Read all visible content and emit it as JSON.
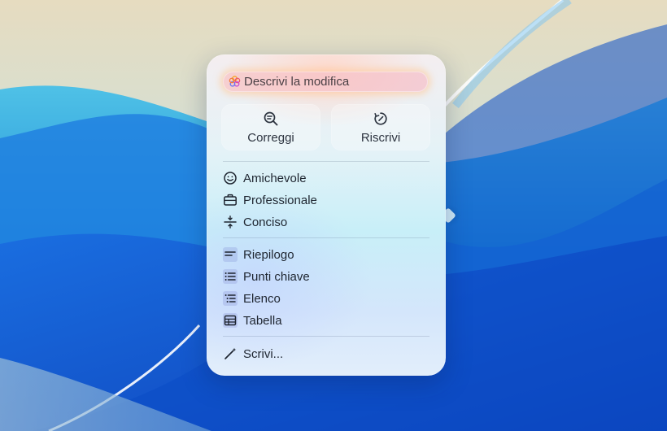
{
  "describe": {
    "placeholder": "Descrivi la modifica",
    "icon": "apple-intelligence-icon"
  },
  "actions": [
    {
      "label": "Correggi",
      "icon": "proofread-magnifier-icon"
    },
    {
      "label": "Riscrivi",
      "icon": "rewrite-refresh-icon"
    }
  ],
  "tones": [
    {
      "label": "Amichevole",
      "icon": "smiley-face-icon"
    },
    {
      "label": "Professionale",
      "icon": "briefcase-icon"
    },
    {
      "label": "Conciso",
      "icon": "compress-lines-icon"
    }
  ],
  "transforms": [
    {
      "label": "Riepilogo",
      "icon": "summary-lines-icon"
    },
    {
      "label": "Punti chiave",
      "icon": "key-points-list-icon"
    },
    {
      "label": "Elenco",
      "icon": "bulleted-list-icon"
    },
    {
      "label": "Tabella",
      "icon": "table-icon"
    }
  ],
  "compose": {
    "label": "Scrivi...",
    "icon": "magic-wand-icon"
  },
  "colors": {
    "panel_glow": "#ffd6c8",
    "text": "#1e2530",
    "icon_accent_box": "#6e78c8"
  }
}
